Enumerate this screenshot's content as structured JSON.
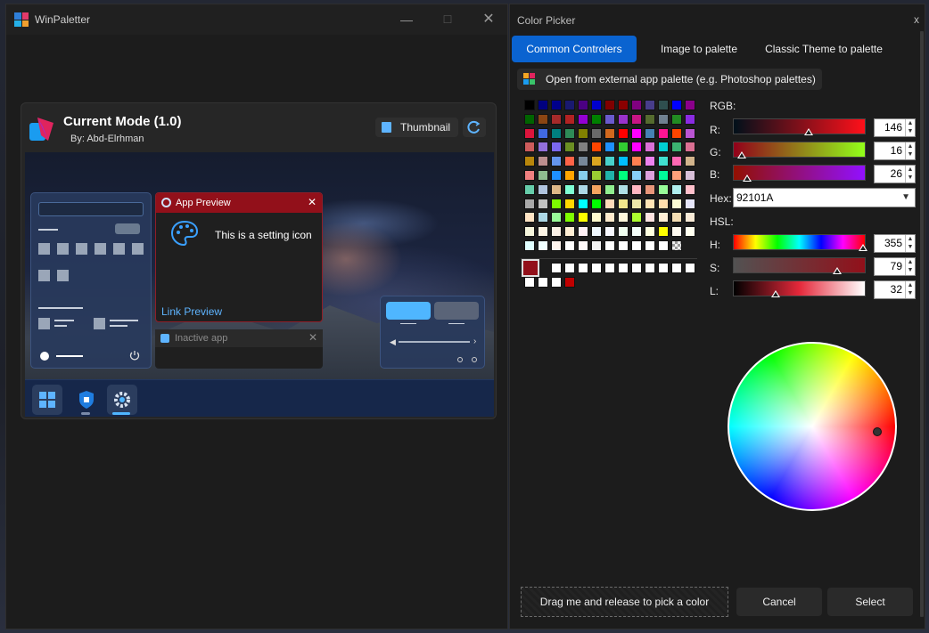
{
  "left_window": {
    "title": "WinPaletter",
    "minimize": "—",
    "maximize": "☐",
    "close": "✕",
    "card": {
      "title": "Current Mode (1.0)",
      "author": "By: Abd-Elrhman",
      "thumbnail_label": "Thumbnail"
    },
    "preview": {
      "app_preview_title": "App Preview",
      "app_preview_text": "This is a setting icon",
      "link_text": "Link Preview",
      "inactive_title": "Inactive app",
      "close_glyph": "✕"
    }
  },
  "color_picker": {
    "title": "Color Picker",
    "close": "x",
    "tabs": [
      "Common Controlers",
      "Image to palette",
      "Classic Theme to palette"
    ],
    "active_tab": 0,
    "external_button": "Open from external app palette (e.g. Photoshop palettes)",
    "rgb_label": "RGB:",
    "r_label": "R:",
    "g_label": "G:",
    "b_label": "B:",
    "hex_label": "Hex:",
    "hsl_label": "HSL:",
    "h_label": "H:",
    "s_label": "S:",
    "l_label": "L:",
    "r_value": "146",
    "g_value": "16",
    "b_value": "26",
    "hex_value": "92101A",
    "h_value": "355",
    "s_value": "79",
    "l_value": "32",
    "r_fraction": 0.573,
    "g_fraction": 0.063,
    "b_fraction": 0.102,
    "h_fraction": 0.986,
    "s_fraction": 0.79,
    "l_fraction": 0.32,
    "drag_text": "Drag me and release to pick a color",
    "cancel": "Cancel",
    "select": "Select",
    "selected_color": "#92101A",
    "palette_rows": [
      [
        "#000000",
        "#000080",
        "#00008b",
        "#191970",
        "#4b0082",
        "#0000cd",
        "#800000",
        "#8b0000",
        "#800080",
        "#483d8b",
        "#2f4f4f",
        "#0000ff",
        "#8b008b"
      ],
      [
        "#006400",
        "#8b4513",
        "#a52a2a",
        "#b22222",
        "#9400d3",
        "#008000",
        "#6a5acd",
        "#9932cc",
        "#c71585",
        "#556b2f",
        "#708090",
        "#228b22",
        "#8a2be2"
      ],
      [
        "#dc143c",
        "#4169e1",
        "#008080",
        "#2e8b57",
        "#808000",
        "#696969",
        "#d2691e",
        "#ff0000",
        "#ff00ff",
        "#4682b4",
        "#ff1493",
        "#ff4500",
        "#ba55d3"
      ],
      [
        "#cd5c5c",
        "#9370db",
        "#7b68ee",
        "#6b8e23",
        "#808080",
        "#ff4500",
        "#1e90ff",
        "#32cd32",
        "#ff00ff",
        "#da70d6",
        "#00ced1",
        "#3cb371",
        "#db7093"
      ],
      [
        "#b8860b",
        "#bc8f8f",
        "#6495ed",
        "#ff6347",
        "#778899",
        "#daa520",
        "#48d1cc",
        "#00bfff",
        "#ff7f50",
        "#ee82ee",
        "#40e0d0",
        "#ff69b4",
        "#d2b48c"
      ],
      [
        "#f08080",
        "#8fbc8f",
        "#1e90ff",
        "#ffa500",
        "#87ceeb",
        "#9acd32",
        "#20b2aa",
        "#00ff7f",
        "#87cefa",
        "#dda0dd",
        "#00fa9a",
        "#ffa07a",
        "#d8bfd8"
      ],
      [
        "#66cdaa",
        "#b0c4de",
        "#deb887",
        "#7fffd4",
        "#add8e6",
        "#f4a460",
        "#90ee90",
        "#b0e0e6",
        "#ffb6c1",
        "#e9967a",
        "#98fb98",
        "#afeeee",
        "#ffc0cb"
      ],
      [
        "#a9a9a9",
        "#c0c0c0",
        "#7cfc00",
        "#ffd700",
        "#00ffff",
        "#00ff00",
        "#ffdab9",
        "#f0e68c",
        "#eee8aa",
        "#ffe4b5",
        "#ffdead",
        "#fafad2",
        "#e6e6fa"
      ],
      [
        "#ffe4c4",
        "#add8e6",
        "#98fb98",
        "#7fff00",
        "#ffff00",
        "#fffacd",
        "#ffebcd",
        "#fff8dc",
        "#adff2f",
        "#ffe4e1",
        "#ffefd5",
        "#f5deb3",
        "#faebd7"
      ],
      [
        "#f5f5dc",
        "#fdf5e6",
        "#faf0e6",
        "#ffefd5",
        "#fff0f5",
        "#f0f8ff",
        "#f8f8ff",
        "#f0fff0",
        "#f5fffa",
        "#ffffe0",
        "#ffff00",
        "#fffaf0",
        "#fffff0"
      ],
      [
        "#e0ffff",
        "#f0ffff",
        "#fff5ee",
        "#ffffff",
        "#fffafa",
        "#f5f5f5",
        "#ffffff",
        "#ffffff",
        "#ffffff",
        "#ffffff",
        "#ffffff",
        "checker"
      ]
    ],
    "custom_row1": [
      "#ffffff",
      "#ffffff",
      "#ffffff",
      "#ffffff",
      "#ffffff",
      "#ffffff",
      "#ffffff",
      "#ffffff",
      "#ffffff",
      "#ffffff",
      "#ffffff"
    ],
    "custom_row2": [
      "#ffffff",
      "#ffffff",
      "#ffffff",
      "#c00000"
    ]
  }
}
